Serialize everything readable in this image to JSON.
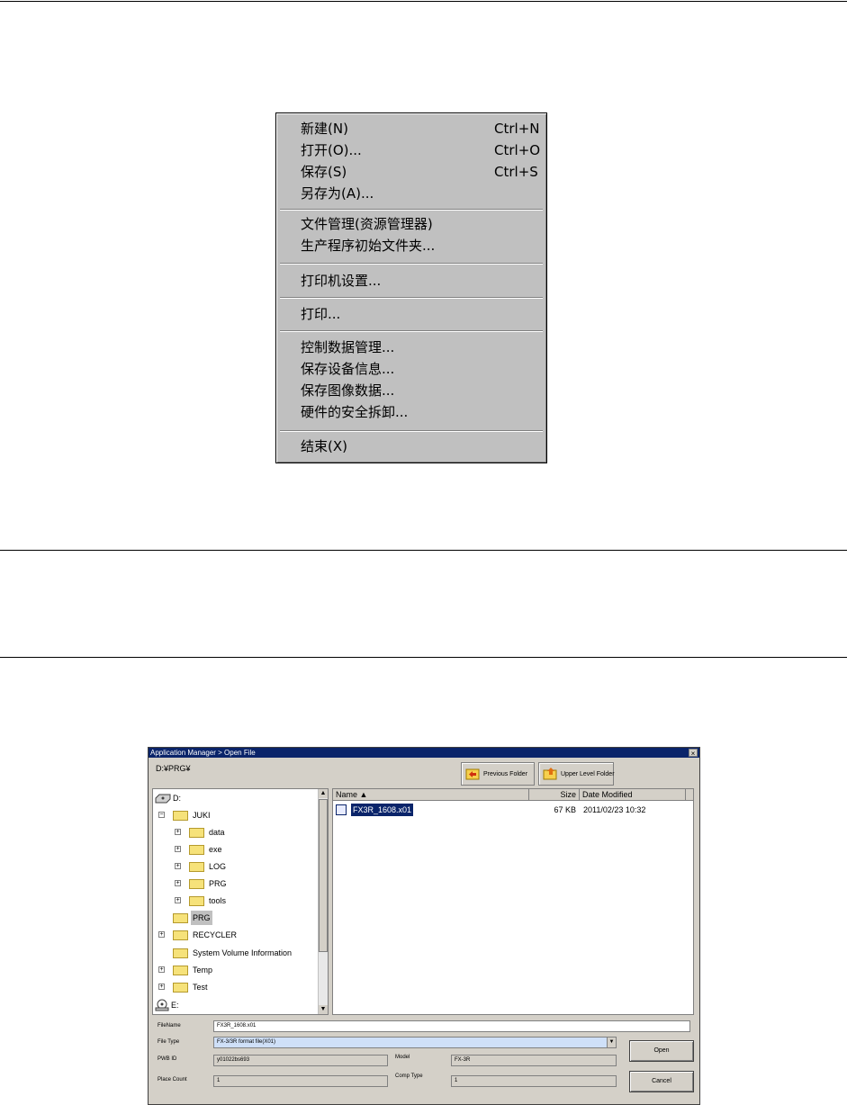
{
  "file_menu": {
    "items": [
      {
        "label": "新建(N)",
        "shortcut": "Ctrl+N"
      },
      {
        "label": "打开(O)...",
        "shortcut": "Ctrl+O"
      },
      {
        "label": "保存(S)",
        "shortcut": "Ctrl+S"
      },
      {
        "label": "另存为(A)...",
        "shortcut": ""
      },
      {
        "label": "文件管理(资源管理器)",
        "shortcut": ""
      },
      {
        "label": "生产程序初始文件夹...",
        "shortcut": ""
      },
      {
        "label": "打印机设置...",
        "shortcut": ""
      },
      {
        "label": "打印...",
        "shortcut": ""
      },
      {
        "label": "控制数据管理...",
        "shortcut": ""
      },
      {
        "label": "保存设备信息...",
        "shortcut": ""
      },
      {
        "label": "保存图像数据...",
        "shortcut": ""
      },
      {
        "label": "硬件的安全拆卸...",
        "shortcut": ""
      },
      {
        "label": "结束(X)",
        "shortcut": ""
      }
    ]
  },
  "dialog": {
    "title": "Application Manager > Open File",
    "close_glyph": "×",
    "current_path": "D:¥PRG¥",
    "toolbar": {
      "previous_folder": "Previous Folder",
      "upper_level_folder": "Upper Level Folder"
    },
    "tree": {
      "drive_d": "D:",
      "juki": "JUKI",
      "data": "data",
      "exe": "exe",
      "log": "LOG",
      "prg_sub": "PRG",
      "tools": "tools",
      "prg": "PRG",
      "recycler": "RECYCLER",
      "svi": "System Volume Information",
      "temp": "Temp",
      "test": "Test",
      "drive_e": "E:"
    },
    "list": {
      "columns": {
        "name": "Name ▲",
        "size": "Size",
        "date": "Date Modified"
      },
      "rows": [
        {
          "name": "FX3R_1608.x01",
          "size": "67 KB",
          "date": "2011/02/23 10:32"
        }
      ]
    },
    "fields": {
      "filename_label": "FileName",
      "filename_value": "FX3R_1608.x01",
      "filetype_label": "File Type",
      "filetype_value": "FX-3/3R format file(X01)",
      "pwb_label": "PWB ID",
      "pwb_value": "y01022bs693",
      "model_label": "Model",
      "model_value": "FX-3R",
      "place_label": "Place Count",
      "place_value": "1",
      "comp_label": "Comp Type",
      "comp_value": "1"
    },
    "buttons": {
      "open": "Open",
      "cancel": "Cancel"
    }
  }
}
